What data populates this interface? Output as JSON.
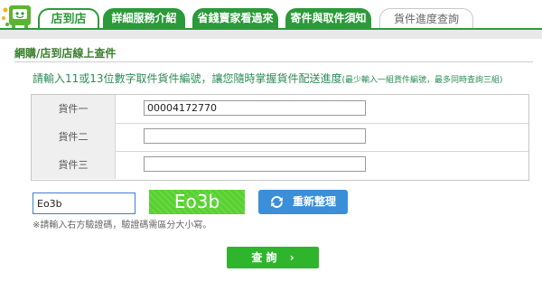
{
  "nav": {
    "home_label": "店到店",
    "tabs": [
      {
        "label": "詳細服務介紹"
      },
      {
        "label": "省錢賣家看過來"
      },
      {
        "label": "寄件與取件須知"
      },
      {
        "label": "貨件進度查詢"
      }
    ]
  },
  "page": {
    "title": "網購/店到店線上查件",
    "intro": "請輸入11或13位數字取件貨件編號，讓您隨時掌握貨件配送進度",
    "intro_note": "(最少輸入一組貨件編號，最多同時查詢三組)"
  },
  "form": {
    "rows": [
      {
        "label": "貨件一",
        "value": "00004172770"
      },
      {
        "label": "貨件二",
        "value": ""
      },
      {
        "label": "貨件三",
        "value": ""
      }
    ]
  },
  "captcha": {
    "input_value": "Eo3b",
    "image_text": "Eo3b",
    "refresh_label": "重新整理",
    "note": "※請輸入右方驗證碼，驗證碼需區分大小寫。"
  },
  "actions": {
    "query_label": "查 詢"
  },
  "colors": {
    "brand_green": "#2c9a3a",
    "captcha_green": "#56d12e",
    "refresh_blue": "#3a8fd8",
    "query_green": "#2fb52b"
  }
}
